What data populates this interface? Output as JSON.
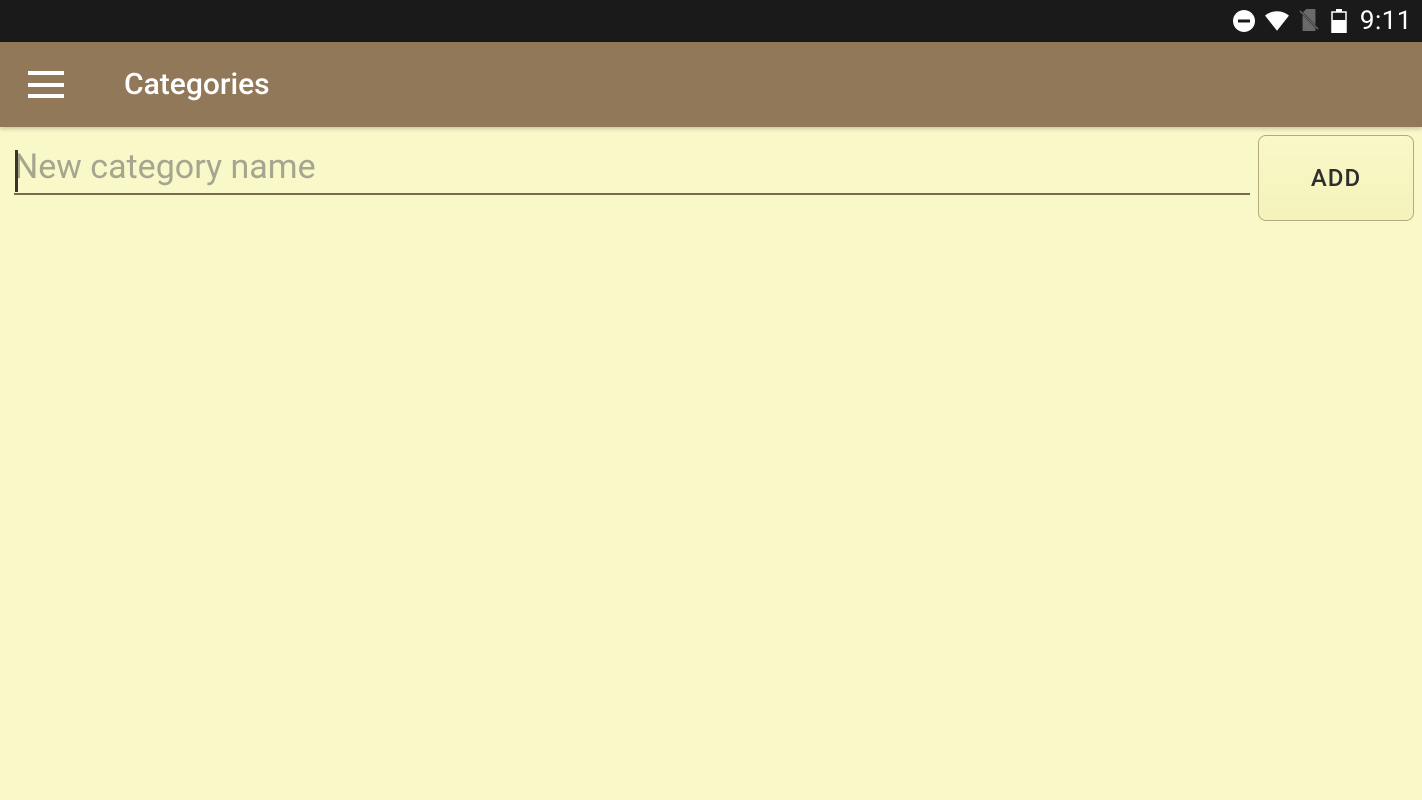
{
  "status_bar": {
    "time": "9:11"
  },
  "app_bar": {
    "title": "Categories"
  },
  "input": {
    "placeholder": "New category name",
    "value": "",
    "add_button_label": "ADD"
  }
}
